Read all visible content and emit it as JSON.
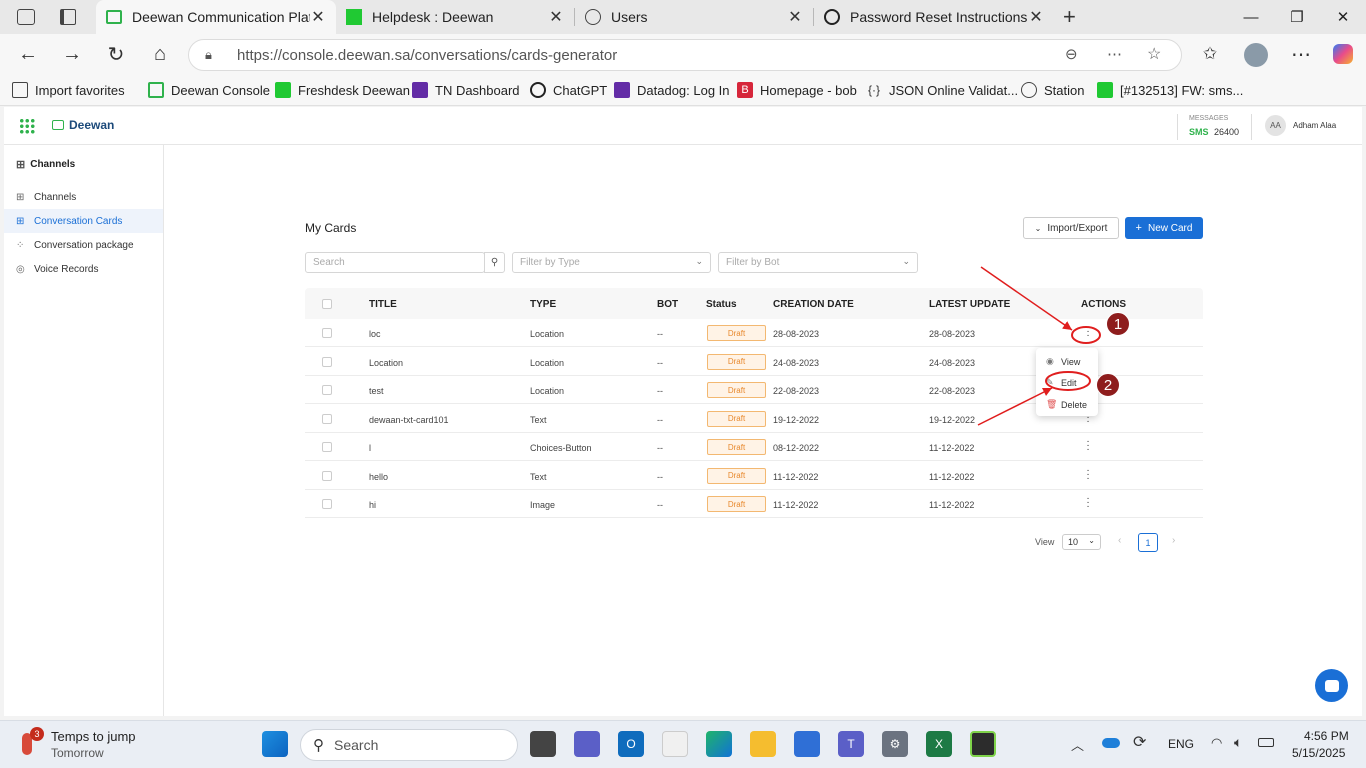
{
  "browser": {
    "tabs": [
      {
        "title": "Deewan Communication Platform",
        "active": true
      },
      {
        "title": "Helpdesk : Deewan",
        "active": false
      },
      {
        "title": "Users",
        "active": false
      },
      {
        "title": "Password Reset Instructions",
        "active": false
      }
    ],
    "url": "https://console.deewan.sa/conversations/cards-generator",
    "favorites": [
      "Import favorites",
      "Deewan Console",
      "Freshdesk Deewan",
      "TN Dashboard",
      "ChatGPT",
      "Datadog: Log In",
      "Homepage - bob",
      "JSON Online Validat...",
      "Station",
      "[#132513] FW: sms..."
    ]
  },
  "app": {
    "brand": "Deewan",
    "messages_label": "MESSAGES",
    "sms_label": "SMS",
    "sms_count": "26400",
    "user_initials": "AA",
    "user_name": "Adham Alaa"
  },
  "sidebar": {
    "heading": "Channels",
    "items": [
      {
        "label": "Channels",
        "icon": "plus-square-icon",
        "active": false
      },
      {
        "label": "Conversation Cards",
        "icon": "plus-square-icon",
        "active": true
      },
      {
        "label": "Conversation package",
        "icon": "grid-icon",
        "active": false
      },
      {
        "label": "Voice Records",
        "icon": "mic-icon",
        "active": false
      }
    ]
  },
  "page": {
    "title": "My Cards",
    "import_export_label": "Import/Export",
    "new_card_label": "New Card",
    "search_placeholder": "Search",
    "filter_type_placeholder": "Filter by Type",
    "filter_bot_placeholder": "Filter by Bot"
  },
  "table": {
    "headers": {
      "title": "TITLE",
      "type": "TYPE",
      "bot": "BOT",
      "status": "Status",
      "created": "CREATION DATE",
      "updated": "LATEST UPDATE",
      "actions": "ACTIONS"
    },
    "rows": [
      {
        "title": "loc",
        "type": "Location",
        "bot": "--",
        "status": "Draft",
        "created": "28-08-2023",
        "updated": "28-08-2023"
      },
      {
        "title": "Location",
        "type": "Location",
        "bot": "--",
        "status": "Draft",
        "created": "24-08-2023",
        "updated": "24-08-2023"
      },
      {
        "title": "test",
        "type": "Location",
        "bot": "--",
        "status": "Draft",
        "created": "22-08-2023",
        "updated": "22-08-2023"
      },
      {
        "title": "dewaan-txt-card101",
        "type": "Text",
        "bot": "--",
        "status": "Draft",
        "created": "19-12-2022",
        "updated": "19-12-2022"
      },
      {
        "title": "l",
        "type": "Choices-Button",
        "bot": "--",
        "status": "Draft",
        "created": "08-12-2022",
        "updated": "11-12-2022"
      },
      {
        "title": "hello",
        "type": "Text",
        "bot": "--",
        "status": "Draft",
        "created": "11-12-2022",
        "updated": "11-12-2022"
      },
      {
        "title": "hi",
        "type": "Image",
        "bot": "--",
        "status": "Draft",
        "created": "11-12-2022",
        "updated": "11-12-2022"
      }
    ]
  },
  "action_menu": {
    "view": "View",
    "edit": "Edit",
    "delete": "Delete"
  },
  "pagination": {
    "view_label": "View",
    "page_size": "10",
    "current_page": "1"
  },
  "annotations": {
    "callout_1": "1",
    "callout_2": "2",
    "color": "#e01e1e"
  },
  "taskbar": {
    "weather_title": "Temps to jump",
    "weather_sub": "Tomorrow",
    "weather_badge": "3",
    "search_placeholder": "Search",
    "language": "ENG",
    "time": "4:56 PM",
    "date": "5/15/2025"
  },
  "colors": {
    "primary": "#1a6fd6",
    "draft": "#e8892e",
    "brand_green": "#2fb24c"
  }
}
